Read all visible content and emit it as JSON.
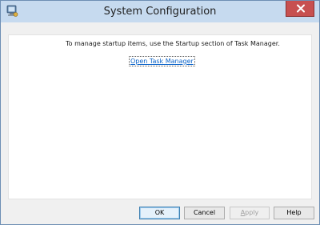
{
  "window": {
    "title": "System Configuration"
  },
  "content": {
    "message": "To manage startup items, use the Startup section of Task Manager.",
    "link": "Open Task Manager"
  },
  "buttons": {
    "ok": "OK",
    "cancel_prefix": "Cancel",
    "apply_mnemonic": "A",
    "apply_rest": "pply",
    "help": "Help"
  },
  "colors": {
    "titlebar": "#c6daef",
    "close": "#c75050",
    "link": "#0a63c9"
  },
  "icons": {
    "app": "system-configuration-icon",
    "close": "close-icon"
  }
}
